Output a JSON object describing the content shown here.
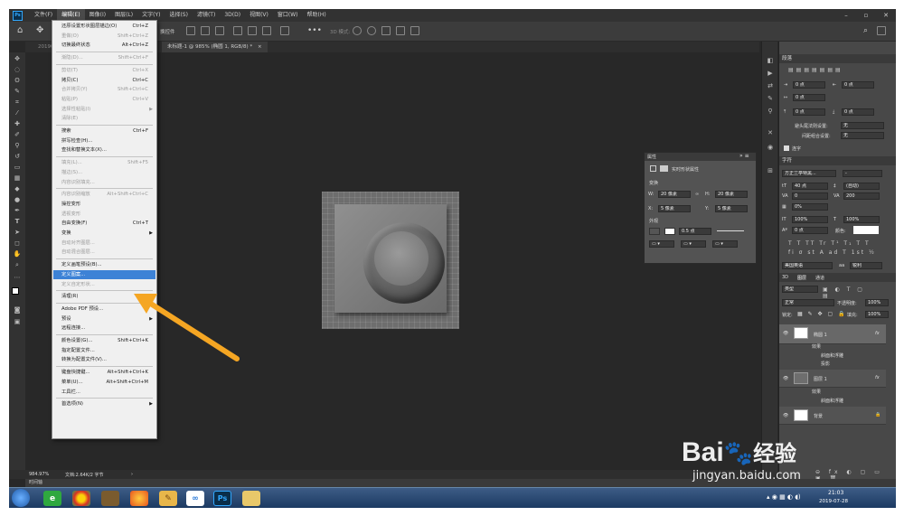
{
  "menubar": {
    "logo": "Ps",
    "items": [
      "文件(F)",
      "编辑(E)",
      "图像(I)",
      "图层(L)",
      "文字(Y)",
      "选择(S)",
      "滤镜(T)",
      "3D(D)",
      "视图(V)",
      "窗口(W)",
      "帮助(H)"
    ],
    "window_controls": [
      "–",
      "▫",
      "✕"
    ]
  },
  "optionsbar": {
    "partial_label": "换控件",
    "threed_label": "3D 模式:"
  },
  "tabs": {
    "hidden_tab": "20190",
    "active_tab": "未标题-1 @ 985% (椭圆 1, RGB/8) *",
    "close": "×"
  },
  "edit_menu": {
    "items": [
      {
        "label": "还原设置形状图层描边(O)",
        "shortcut": "Ctrl+Z",
        "disabled": false
      },
      {
        "label": "重做(O)",
        "shortcut": "Shift+Ctrl+Z",
        "disabled": true
      },
      {
        "label": "切换最终状态",
        "shortcut": "Alt+Ctrl+Z",
        "disabled": false
      },
      {
        "sep": true
      },
      {
        "label": "渐隐(D)...",
        "shortcut": "Shift+Ctrl+F",
        "disabled": true
      },
      {
        "sep": true
      },
      {
        "label": "剪切(T)",
        "shortcut": "Ctrl+X",
        "disabled": true
      },
      {
        "label": "拷贝(C)",
        "shortcut": "Ctrl+C",
        "disabled": false
      },
      {
        "label": "合并拷贝(Y)",
        "shortcut": "Shift+Ctrl+C",
        "disabled": true
      },
      {
        "label": "粘贴(P)",
        "shortcut": "Ctrl+V",
        "disabled": true
      },
      {
        "label": "选择性粘贴(I)",
        "shortcut": "",
        "disabled": true,
        "submenu": true
      },
      {
        "label": "清除(E)",
        "shortcut": "",
        "disabled": true
      },
      {
        "sep": true
      },
      {
        "label": "搜索",
        "shortcut": "Ctrl+F",
        "disabled": false
      },
      {
        "label": "拼写检查(H)...",
        "shortcut": "",
        "disabled": false
      },
      {
        "label": "查找和替换文本(X)...",
        "shortcut": "",
        "disabled": false
      },
      {
        "sep": true
      },
      {
        "label": "填充(L)...",
        "shortcut": "Shift+F5",
        "disabled": true
      },
      {
        "label": "描边(S)...",
        "shortcut": "",
        "disabled": true
      },
      {
        "label": "内容识别填充...",
        "shortcut": "",
        "disabled": true
      },
      {
        "sep": true
      },
      {
        "label": "内容识别缩放",
        "shortcut": "Alt+Shift+Ctrl+C",
        "disabled": true
      },
      {
        "label": "操控变形",
        "shortcut": "",
        "disabled": false
      },
      {
        "label": "透视变形",
        "shortcut": "",
        "disabled": true
      },
      {
        "label": "自由变换(F)",
        "shortcut": "Ctrl+T",
        "disabled": false
      },
      {
        "label": "变换",
        "shortcut": "",
        "disabled": false,
        "submenu": true
      },
      {
        "label": "自动对齐图层...",
        "shortcut": "",
        "disabled": true
      },
      {
        "label": "自动混合图层...",
        "shortcut": "",
        "disabled": true
      },
      {
        "sep": true
      },
      {
        "label": "定义画笔预设(B)...",
        "shortcut": "",
        "disabled": false
      },
      {
        "label": "定义图案...",
        "shortcut": "",
        "disabled": false,
        "highlight": true
      },
      {
        "label": "定义自定形状...",
        "shortcut": "",
        "disabled": true
      },
      {
        "sep": true
      },
      {
        "label": "清理(R)",
        "shortcut": "",
        "disabled": false,
        "submenu": true
      },
      {
        "sep": true
      },
      {
        "label": "Adobe PDF 预设...",
        "shortcut": "",
        "disabled": false
      },
      {
        "label": "预设",
        "shortcut": "",
        "disabled": false,
        "submenu": true
      },
      {
        "label": "远程连接...",
        "shortcut": "",
        "disabled": false
      },
      {
        "sep": true
      },
      {
        "label": "颜色设置(G)...",
        "shortcut": "Shift+Ctrl+K",
        "disabled": false
      },
      {
        "label": "指定配置文件...",
        "shortcut": "",
        "disabled": false
      },
      {
        "label": "转换为配置文件(V)...",
        "shortcut": "",
        "disabled": false
      },
      {
        "sep": true
      },
      {
        "label": "键盘快捷键...",
        "shortcut": "Alt+Shift+Ctrl+K",
        "disabled": false
      },
      {
        "label": "菜单(U)...",
        "shortcut": "Alt+Shift+Ctrl+M",
        "disabled": false
      },
      {
        "label": "工具栏...",
        "shortcut": "",
        "disabled": false
      },
      {
        "sep": true
      },
      {
        "label": "首选项(N)",
        "shortcut": "",
        "disabled": false,
        "submenu": true
      }
    ]
  },
  "properties_panel": {
    "title": "属性",
    "subtitle": "实时形状属性",
    "section_transform": "变换",
    "w_label": "W:",
    "w_value": "20 像素",
    "h_label": "H:",
    "h_value": "20 像素",
    "x_label": "X:",
    "x_value": "5 像素",
    "y_label": "Y:",
    "y_value": "5 像素",
    "section_appearance": "外观",
    "stroke_value": "0.5 点"
  },
  "paragraph_panel": {
    "title": "段落",
    "indent_left": "0 点",
    "indent_right": "0 点",
    "indent_first": "0 点",
    "space_before": "0 点",
    "space_after": "0 点",
    "avoid_label": "避头尾法则设置:",
    "avoid_value": "无",
    "spacing_label": "间距组合设置:",
    "spacing_value": "无",
    "hyphen_label": "连字"
  },
  "character_panel": {
    "title": "字符",
    "font_family": "方正兰亭特黑...",
    "font_style": "-",
    "font_size": "40 点",
    "leading": "(自动)",
    "tracking_left": "0",
    "kerning": "200",
    "scale_pct": "0%",
    "vertical_scale": "100%",
    "horizontal_scale": "100%",
    "baseline": "0 点",
    "color_label": "颜色:",
    "language": "美国英语",
    "antialias": "锐利"
  },
  "layers_panel": {
    "tabs": [
      "3D",
      "图层",
      "通道"
    ],
    "filter": "类型",
    "blend_mode": "正常",
    "opacity_label": "不透明度:",
    "opacity_value": "100%",
    "lock_label": "锁定:",
    "fill_label": "填充:",
    "fill_value": "100%",
    "layers": [
      {
        "name": "椭圆 1",
        "fx": "fx",
        "effects_label": "效果",
        "effects": [
          "斜面和浮雕",
          "投影"
        ]
      },
      {
        "name": "图层 1",
        "fx": "fx",
        "effects_label": "效果",
        "effects": [
          "斜面和浮雕"
        ]
      },
      {
        "name": "背景"
      }
    ]
  },
  "statusbar": {
    "zoom": "984.97%",
    "doc_info": "文档:2.64K/2 字节"
  },
  "timeline": {
    "label": "时间轴"
  },
  "taskbar": {
    "clock_time": "21:03",
    "clock_date": "2019-07-28"
  },
  "watermark": {
    "logo": "Bai",
    "logo_suffix": "经验",
    "url": "jingyan.baidu.com"
  },
  "colors": {
    "highlight": "#3d82d6",
    "arrow": "#f5a623",
    "ps_blue": "#31a8ff"
  }
}
